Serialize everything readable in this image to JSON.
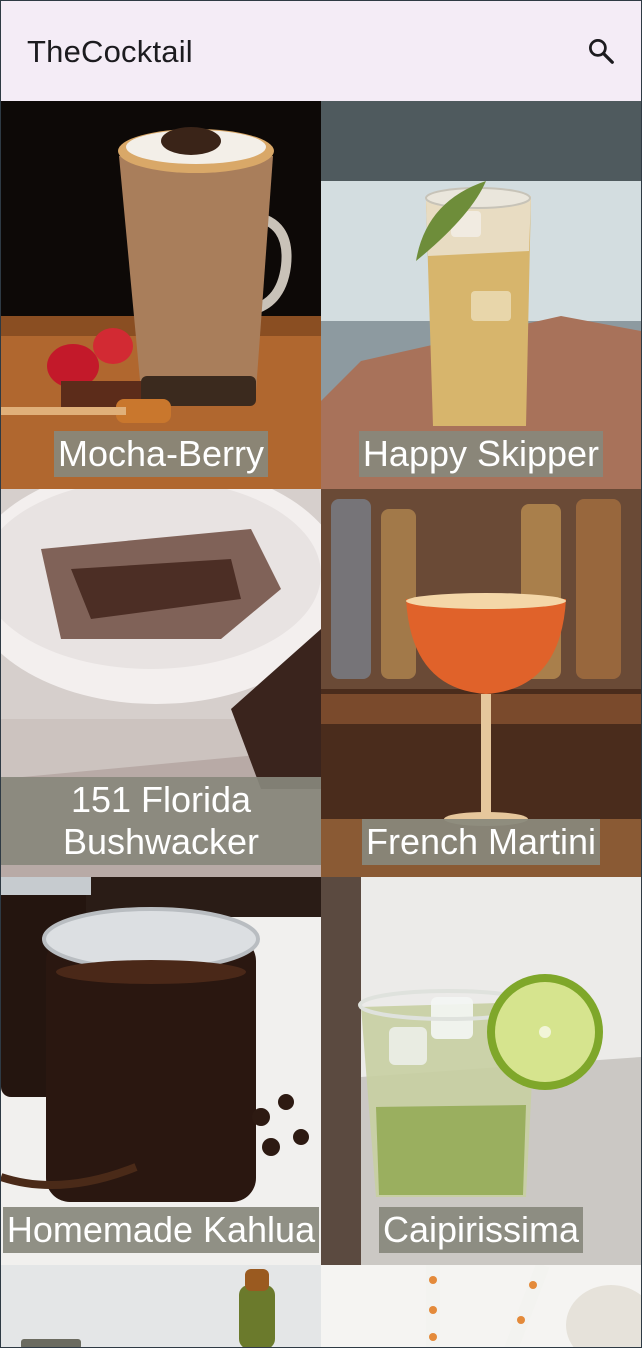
{
  "appbar": {
    "title": "TheCocktail",
    "search_icon": "search-icon"
  },
  "drinks": [
    {
      "name": "Mocha-Berry"
    },
    {
      "name": "Happy Skipper"
    },
    {
      "name": "151 Florida Bushwacker"
    },
    {
      "name": "French Martini"
    },
    {
      "name": "Homemade Kahlua"
    },
    {
      "name": "Caipirissima"
    },
    {
      "name": ""
    },
    {
      "name": ""
    }
  ],
  "colors": {
    "appbar_background": "#f4ecf6",
    "caption_background": "#88887c",
    "caption_text": "#ffffff"
  }
}
